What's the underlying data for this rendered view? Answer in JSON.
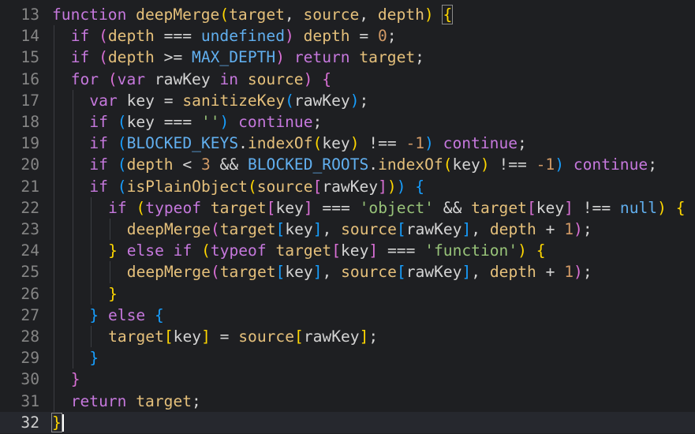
{
  "colors": {
    "background": "#1e1f22",
    "current_line": "#26282e",
    "line_number": "#858585",
    "keyword": "#c678dd",
    "function_name": "#e5c07b",
    "variable": "#e5c07b",
    "constant": "#61afef",
    "number": "#d19a66",
    "string": "#98c379",
    "operator": "#d4d4d4",
    "bracket_1": "#ffd700",
    "bracket_2": "#da70d6",
    "bracket_3": "#179fff"
  },
  "editor": {
    "lines": [
      {
        "number": "13",
        "indent": 0,
        "tokens": [
          {
            "t": "function",
            "c": "keyword"
          },
          {
            "t": " ",
            "c": "operator"
          },
          {
            "t": "deepMerge",
            "c": "function_name"
          },
          {
            "t": "(",
            "c": "bracket_1"
          },
          {
            "t": "target",
            "c": "variable"
          },
          {
            "t": ", ",
            "c": "operator"
          },
          {
            "t": "source",
            "c": "variable"
          },
          {
            "t": ", ",
            "c": "operator"
          },
          {
            "t": "depth",
            "c": "variable"
          },
          {
            "t": ")",
            "c": "bracket_1"
          },
          {
            "t": " ",
            "c": "operator"
          },
          {
            "t": "{",
            "c": "bracket_1",
            "box": true
          }
        ]
      },
      {
        "number": "14",
        "indent": 1,
        "tokens": [
          {
            "t": "if",
            "c": "keyword"
          },
          {
            "t": " ",
            "c": "operator"
          },
          {
            "t": "(",
            "c": "bracket_2"
          },
          {
            "t": "depth",
            "c": "variable"
          },
          {
            "t": " === ",
            "c": "operator"
          },
          {
            "t": "undefined",
            "c": "constant"
          },
          {
            "t": ")",
            "c": "bracket_2"
          },
          {
            "t": " ",
            "c": "operator"
          },
          {
            "t": "depth",
            "c": "variable"
          },
          {
            "t": " = ",
            "c": "operator"
          },
          {
            "t": "0",
            "c": "number"
          },
          {
            "t": ";",
            "c": "operator"
          }
        ]
      },
      {
        "number": "15",
        "indent": 1,
        "tokens": [
          {
            "t": "if",
            "c": "keyword"
          },
          {
            "t": " ",
            "c": "operator"
          },
          {
            "t": "(",
            "c": "bracket_2"
          },
          {
            "t": "depth",
            "c": "variable"
          },
          {
            "t": " >= ",
            "c": "operator"
          },
          {
            "t": "MAX_DEPTH",
            "c": "constant"
          },
          {
            "t": ")",
            "c": "bracket_2"
          },
          {
            "t": " ",
            "c": "operator"
          },
          {
            "t": "return",
            "c": "keyword"
          },
          {
            "t": " ",
            "c": "operator"
          },
          {
            "t": "target",
            "c": "variable"
          },
          {
            "t": ";",
            "c": "operator"
          }
        ]
      },
      {
        "number": "16",
        "indent": 1,
        "tokens": [
          {
            "t": "for",
            "c": "keyword"
          },
          {
            "t": " ",
            "c": "operator"
          },
          {
            "t": "(",
            "c": "bracket_2"
          },
          {
            "t": "var",
            "c": "keyword"
          },
          {
            "t": " rawKey ",
            "c": "operator"
          },
          {
            "t": "in",
            "c": "keyword"
          },
          {
            "t": " ",
            "c": "operator"
          },
          {
            "t": "source",
            "c": "variable"
          },
          {
            "t": ")",
            "c": "bracket_2"
          },
          {
            "t": " ",
            "c": "operator"
          },
          {
            "t": "{",
            "c": "bracket_2"
          }
        ]
      },
      {
        "number": "17",
        "indent": 2,
        "tokens": [
          {
            "t": "var",
            "c": "keyword"
          },
          {
            "t": " key = ",
            "c": "operator"
          },
          {
            "t": "sanitizeKey",
            "c": "function_name"
          },
          {
            "t": "(",
            "c": "bracket_3"
          },
          {
            "t": "rawKey",
            "c": "operator"
          },
          {
            "t": ")",
            "c": "bracket_3"
          },
          {
            "t": ";",
            "c": "operator"
          }
        ]
      },
      {
        "number": "18",
        "indent": 2,
        "tokens": [
          {
            "t": "if",
            "c": "keyword"
          },
          {
            "t": " ",
            "c": "operator"
          },
          {
            "t": "(",
            "c": "bracket_3"
          },
          {
            "t": "key === ",
            "c": "operator"
          },
          {
            "t": "''",
            "c": "string"
          },
          {
            "t": ")",
            "c": "bracket_3"
          },
          {
            "t": " ",
            "c": "operator"
          },
          {
            "t": "continue",
            "c": "keyword"
          },
          {
            "t": ";",
            "c": "operator"
          }
        ]
      },
      {
        "number": "19",
        "indent": 2,
        "tokens": [
          {
            "t": "if",
            "c": "keyword"
          },
          {
            "t": " ",
            "c": "operator"
          },
          {
            "t": "(",
            "c": "bracket_3"
          },
          {
            "t": "BLOCKED_KEYS",
            "c": "constant"
          },
          {
            "t": ".",
            "c": "operator"
          },
          {
            "t": "indexOf",
            "c": "function_name"
          },
          {
            "t": "(",
            "c": "bracket_1"
          },
          {
            "t": "key",
            "c": "operator"
          },
          {
            "t": ")",
            "c": "bracket_1"
          },
          {
            "t": " !== ",
            "c": "operator"
          },
          {
            "t": "-1",
            "c": "number"
          },
          {
            "t": ")",
            "c": "bracket_3"
          },
          {
            "t": " ",
            "c": "operator"
          },
          {
            "t": "continue",
            "c": "keyword"
          },
          {
            "t": ";",
            "c": "operator"
          }
        ]
      },
      {
        "number": "20",
        "indent": 2,
        "tokens": [
          {
            "t": "if",
            "c": "keyword"
          },
          {
            "t": " ",
            "c": "operator"
          },
          {
            "t": "(",
            "c": "bracket_3"
          },
          {
            "t": "depth",
            "c": "variable"
          },
          {
            "t": " < ",
            "c": "operator"
          },
          {
            "t": "3",
            "c": "number"
          },
          {
            "t": " && ",
            "c": "operator"
          },
          {
            "t": "BLOCKED_ROOTS",
            "c": "constant"
          },
          {
            "t": ".",
            "c": "operator"
          },
          {
            "t": "indexOf",
            "c": "function_name"
          },
          {
            "t": "(",
            "c": "bracket_1"
          },
          {
            "t": "key",
            "c": "operator"
          },
          {
            "t": ")",
            "c": "bracket_1"
          },
          {
            "t": " !== ",
            "c": "operator"
          },
          {
            "t": "-1",
            "c": "number"
          },
          {
            "t": ")",
            "c": "bracket_3"
          },
          {
            "t": " ",
            "c": "operator"
          },
          {
            "t": "continue",
            "c": "keyword"
          },
          {
            "t": ";",
            "c": "operator"
          }
        ]
      },
      {
        "number": "21",
        "indent": 2,
        "tokens": [
          {
            "t": "if",
            "c": "keyword"
          },
          {
            "t": " ",
            "c": "operator"
          },
          {
            "t": "(",
            "c": "bracket_3"
          },
          {
            "t": "isPlainObject",
            "c": "function_name"
          },
          {
            "t": "(",
            "c": "bracket_1"
          },
          {
            "t": "source",
            "c": "variable"
          },
          {
            "t": "[",
            "c": "bracket_2"
          },
          {
            "t": "rawKey",
            "c": "operator"
          },
          {
            "t": "]",
            "c": "bracket_2"
          },
          {
            "t": ")",
            "c": "bracket_1"
          },
          {
            "t": ")",
            "c": "bracket_3"
          },
          {
            "t": " ",
            "c": "operator"
          },
          {
            "t": "{",
            "c": "bracket_3"
          }
        ]
      },
      {
        "number": "22",
        "indent": 3,
        "tokens": [
          {
            "t": "if",
            "c": "keyword"
          },
          {
            "t": " ",
            "c": "operator"
          },
          {
            "t": "(",
            "c": "bracket_1"
          },
          {
            "t": "typeof",
            "c": "keyword"
          },
          {
            "t": " ",
            "c": "operator"
          },
          {
            "t": "target",
            "c": "variable"
          },
          {
            "t": "[",
            "c": "bracket_2"
          },
          {
            "t": "key",
            "c": "operator"
          },
          {
            "t": "]",
            "c": "bracket_2"
          },
          {
            "t": " === ",
            "c": "operator"
          },
          {
            "t": "'object'",
            "c": "string"
          },
          {
            "t": " && ",
            "c": "operator"
          },
          {
            "t": "target",
            "c": "variable"
          },
          {
            "t": "[",
            "c": "bracket_2"
          },
          {
            "t": "key",
            "c": "operator"
          },
          {
            "t": "]",
            "c": "bracket_2"
          },
          {
            "t": " !== ",
            "c": "operator"
          },
          {
            "t": "null",
            "c": "constant"
          },
          {
            "t": ")",
            "c": "bracket_1"
          },
          {
            "t": " ",
            "c": "operator"
          },
          {
            "t": "{",
            "c": "bracket_1"
          }
        ]
      },
      {
        "number": "23",
        "indent": 4,
        "tokens": [
          {
            "t": "deepMerge",
            "c": "function_name"
          },
          {
            "t": "(",
            "c": "bracket_2"
          },
          {
            "t": "target",
            "c": "variable"
          },
          {
            "t": "[",
            "c": "bracket_3"
          },
          {
            "t": "key",
            "c": "operator"
          },
          {
            "t": "]",
            "c": "bracket_3"
          },
          {
            "t": ", ",
            "c": "operator"
          },
          {
            "t": "source",
            "c": "variable"
          },
          {
            "t": "[",
            "c": "bracket_3"
          },
          {
            "t": "rawKey",
            "c": "operator"
          },
          {
            "t": "]",
            "c": "bracket_3"
          },
          {
            "t": ", ",
            "c": "operator"
          },
          {
            "t": "depth",
            "c": "variable"
          },
          {
            "t": " + ",
            "c": "operator"
          },
          {
            "t": "1",
            "c": "number"
          },
          {
            "t": ")",
            "c": "bracket_2"
          },
          {
            "t": ";",
            "c": "operator"
          }
        ]
      },
      {
        "number": "24",
        "indent": 3,
        "tokens": [
          {
            "t": "}",
            "c": "bracket_1"
          },
          {
            "t": " ",
            "c": "operator"
          },
          {
            "t": "else",
            "c": "keyword"
          },
          {
            "t": " ",
            "c": "operator"
          },
          {
            "t": "if",
            "c": "keyword"
          },
          {
            "t": " ",
            "c": "operator"
          },
          {
            "t": "(",
            "c": "bracket_1"
          },
          {
            "t": "typeof",
            "c": "keyword"
          },
          {
            "t": " ",
            "c": "operator"
          },
          {
            "t": "target",
            "c": "variable"
          },
          {
            "t": "[",
            "c": "bracket_2"
          },
          {
            "t": "key",
            "c": "operator"
          },
          {
            "t": "]",
            "c": "bracket_2"
          },
          {
            "t": " === ",
            "c": "operator"
          },
          {
            "t": "'function'",
            "c": "string"
          },
          {
            "t": ")",
            "c": "bracket_1"
          },
          {
            "t": " ",
            "c": "operator"
          },
          {
            "t": "{",
            "c": "bracket_1"
          }
        ]
      },
      {
        "number": "25",
        "indent": 4,
        "tokens": [
          {
            "t": "deepMerge",
            "c": "function_name"
          },
          {
            "t": "(",
            "c": "bracket_2"
          },
          {
            "t": "target",
            "c": "variable"
          },
          {
            "t": "[",
            "c": "bracket_3"
          },
          {
            "t": "key",
            "c": "operator"
          },
          {
            "t": "]",
            "c": "bracket_3"
          },
          {
            "t": ", ",
            "c": "operator"
          },
          {
            "t": "source",
            "c": "variable"
          },
          {
            "t": "[",
            "c": "bracket_3"
          },
          {
            "t": "rawKey",
            "c": "operator"
          },
          {
            "t": "]",
            "c": "bracket_3"
          },
          {
            "t": ", ",
            "c": "operator"
          },
          {
            "t": "depth",
            "c": "variable"
          },
          {
            "t": " + ",
            "c": "operator"
          },
          {
            "t": "1",
            "c": "number"
          },
          {
            "t": ")",
            "c": "bracket_2"
          },
          {
            "t": ";",
            "c": "operator"
          }
        ]
      },
      {
        "number": "26",
        "indent": 3,
        "tokens": [
          {
            "t": "}",
            "c": "bracket_1"
          }
        ]
      },
      {
        "number": "27",
        "indent": 2,
        "tokens": [
          {
            "t": "}",
            "c": "bracket_3"
          },
          {
            "t": " ",
            "c": "operator"
          },
          {
            "t": "else",
            "c": "keyword"
          },
          {
            "t": " ",
            "c": "operator"
          },
          {
            "t": "{",
            "c": "bracket_3"
          }
        ]
      },
      {
        "number": "28",
        "indent": 3,
        "tokens": [
          {
            "t": "target",
            "c": "variable"
          },
          {
            "t": "[",
            "c": "bracket_1"
          },
          {
            "t": "key",
            "c": "operator"
          },
          {
            "t": "]",
            "c": "bracket_1"
          },
          {
            "t": " = ",
            "c": "operator"
          },
          {
            "t": "source",
            "c": "variable"
          },
          {
            "t": "[",
            "c": "bracket_1"
          },
          {
            "t": "rawKey",
            "c": "operator"
          },
          {
            "t": "]",
            "c": "bracket_1"
          },
          {
            "t": ";",
            "c": "operator"
          }
        ]
      },
      {
        "number": "29",
        "indent": 2,
        "tokens": [
          {
            "t": "}",
            "c": "bracket_3"
          }
        ]
      },
      {
        "number": "30",
        "indent": 1,
        "tokens": [
          {
            "t": "}",
            "c": "bracket_2"
          }
        ]
      },
      {
        "number": "31",
        "indent": 1,
        "tokens": [
          {
            "t": "return",
            "c": "keyword"
          },
          {
            "t": " ",
            "c": "operator"
          },
          {
            "t": "target",
            "c": "variable"
          },
          {
            "t": ";",
            "c": "operator"
          }
        ]
      },
      {
        "number": "32",
        "indent": 0,
        "current": true,
        "caret_after_char": 1,
        "tokens": [
          {
            "t": "}",
            "c": "bracket_1",
            "box": true
          }
        ]
      }
    ]
  }
}
